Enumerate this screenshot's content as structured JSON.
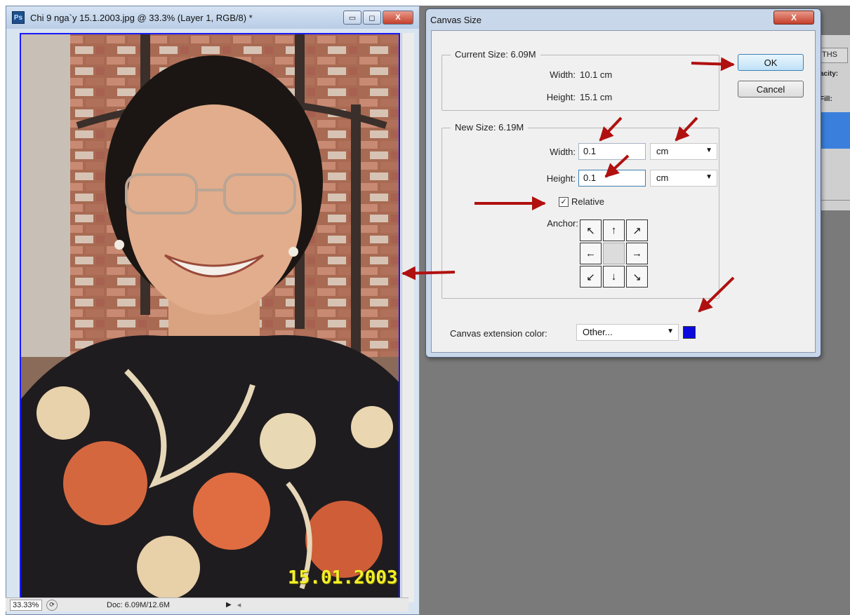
{
  "document_window": {
    "title": "Chi 9 nga`y 15.1.2003.jpg @ 33.3% (Layer 1, RGB/8) *",
    "app_icon": "Ps",
    "minimize_icon": "minimize-icon",
    "maximize_icon": "maximize-icon",
    "close_icon": "close-icon",
    "minimize_glyph": "▭",
    "maximize_glyph": "◻",
    "close_glyph": "X",
    "date_stamp": "15.01.2003",
    "canvas_border_color": "#1a1aff"
  },
  "status_bar": {
    "zoom": "33.33%",
    "doc_info": "Doc: 6.09M/12.6M",
    "arrow": "▶",
    "scroll_left": "◂"
  },
  "panel": {
    "tab_label": "THS",
    "opacity_label": "acity:",
    "fill_label": "Fill:",
    "highlight_color": "#3b7fdc"
  },
  "dialog": {
    "title": "Canvas Size",
    "close_glyph": "X",
    "current_size": {
      "legend": "Current Size: 6.09M",
      "width_label": "Width:",
      "width_value": "10.1 cm",
      "height_label": "Height:",
      "height_value": "15.1 cm"
    },
    "new_size": {
      "legend": "New Size: 6.19M",
      "width_label": "Width:",
      "width_value": "0.1",
      "width_unit": "cm",
      "height_label": "Height:",
      "height_value": "0.1",
      "height_unit": "cm",
      "relative_label": "Relative",
      "relative_checked": true,
      "check_glyph": "✓",
      "anchor_label": "Anchor:",
      "anchor_arrows": [
        "↖",
        "↑",
        "↗",
        "←",
        "",
        "→",
        "↙",
        "↓",
        "↘"
      ]
    },
    "extension_color_label": "Canvas extension color:",
    "extension_color_value": "Other...",
    "extension_color_swatch": "#0a0adf",
    "ok_label": "OK",
    "cancel_label": "Cancel"
  },
  "annotation_arrow_color": "#b01010"
}
